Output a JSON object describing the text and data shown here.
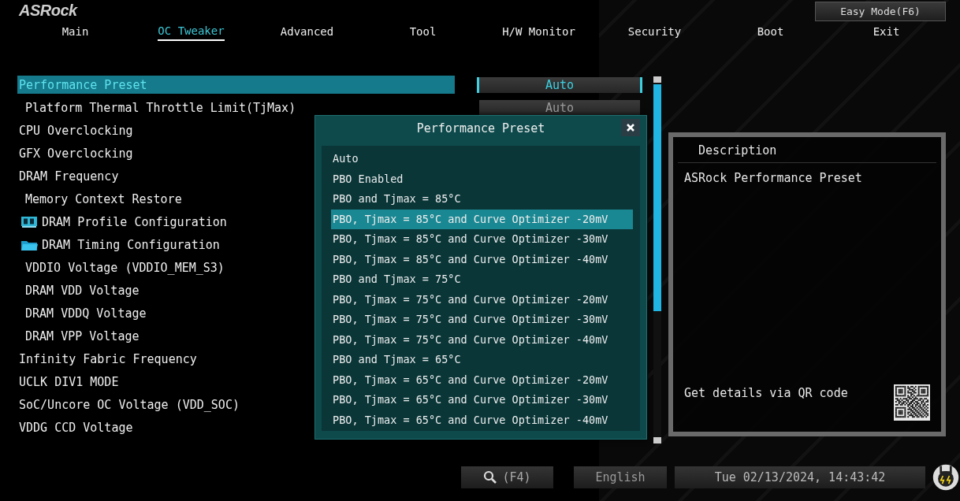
{
  "brand": "ASRock",
  "easy_mode_button": "Easy Mode(F6)",
  "tabs": [
    {
      "label": "Main",
      "selected": false
    },
    {
      "label": "OC Tweaker",
      "selected": true
    },
    {
      "label": "Advanced",
      "selected": false
    },
    {
      "label": "Tool",
      "selected": false
    },
    {
      "label": "H/W Monitor",
      "selected": false
    },
    {
      "label": "Security",
      "selected": false
    },
    {
      "label": "Boot",
      "selected": false
    },
    {
      "label": "Exit",
      "selected": false
    }
  ],
  "settings": [
    {
      "label": "Performance Preset",
      "kind": "item",
      "selected": true,
      "value": "Auto"
    },
    {
      "label": "Platform Thermal Throttle Limit(TjMax)",
      "kind": "sub",
      "selected": false,
      "value": "Auto"
    },
    {
      "label": "CPU Overclocking",
      "kind": "item",
      "selected": false
    },
    {
      "label": "GFX Overclocking",
      "kind": "item",
      "selected": false
    },
    {
      "label": "DRAM Frequency",
      "kind": "item",
      "selected": false
    },
    {
      "label": "Memory Context Restore",
      "kind": "sub",
      "selected": false
    },
    {
      "label": "DRAM Profile Configuration",
      "kind": "memory",
      "selected": false
    },
    {
      "label": "DRAM Timing Configuration",
      "kind": "folder",
      "selected": false
    },
    {
      "label": "VDDIO Voltage (VDDIO_MEM_S3)",
      "kind": "sub",
      "selected": false
    },
    {
      "label": "DRAM VDD Voltage",
      "kind": "sub",
      "selected": false
    },
    {
      "label": "DRAM VDDQ Voltage",
      "kind": "sub",
      "selected": false
    },
    {
      "label": "DRAM VPP Voltage",
      "kind": "sub",
      "selected": false
    },
    {
      "label": "Infinity Fabric Frequency",
      "kind": "item",
      "selected": false
    },
    {
      "label": "UCLK DIV1 MODE",
      "kind": "item",
      "selected": false
    },
    {
      "label": "SoC/Uncore OC Voltage (VDD_SOC)",
      "kind": "item",
      "selected": false
    },
    {
      "label": "VDDG CCD Voltage",
      "kind": "item",
      "selected": false
    }
  ],
  "popup": {
    "title": "Performance Preset",
    "options": [
      {
        "label": "Auto",
        "selected": false
      },
      {
        "label": "PBO Enabled",
        "selected": false
      },
      {
        "label": "PBO and Tjmax = 85°C",
        "selected": false
      },
      {
        "label": "PBO, Tjmax = 85°C and Curve Optimizer -20mV",
        "selected": true
      },
      {
        "label": "PBO, Tjmax = 85°C and Curve Optimizer -30mV",
        "selected": false
      },
      {
        "label": "PBO, Tjmax = 85°C and Curve Optimizer -40mV",
        "selected": false
      },
      {
        "label": "PBO and Tjmax = 75°C",
        "selected": false
      },
      {
        "label": "PBO, Tjmax = 75°C and Curve Optimizer -20mV",
        "selected": false
      },
      {
        "label": "PBO, Tjmax = 75°C and Curve Optimizer -30mV",
        "selected": false
      },
      {
        "label": "PBO, Tjmax = 75°C and Curve Optimizer -40mV",
        "selected": false
      },
      {
        "label": "PBO and Tjmax = 65°C",
        "selected": false
      },
      {
        "label": "PBO, Tjmax = 65°C and Curve Optimizer -20mV",
        "selected": false
      },
      {
        "label": "PBO, Tjmax = 65°C and Curve Optimizer -30mV",
        "selected": false
      },
      {
        "label": "PBO, Tjmax = 65°C and Curve Optimizer -40mV",
        "selected": false
      }
    ]
  },
  "description": {
    "title": "Description",
    "text": "ASRock Performance Preset",
    "qr_hint": "Get details via QR code"
  },
  "status_bar": {
    "search_key": "(F4)",
    "language": "English",
    "datetime": "Tue 02/13/2024, 14:43:42"
  }
}
